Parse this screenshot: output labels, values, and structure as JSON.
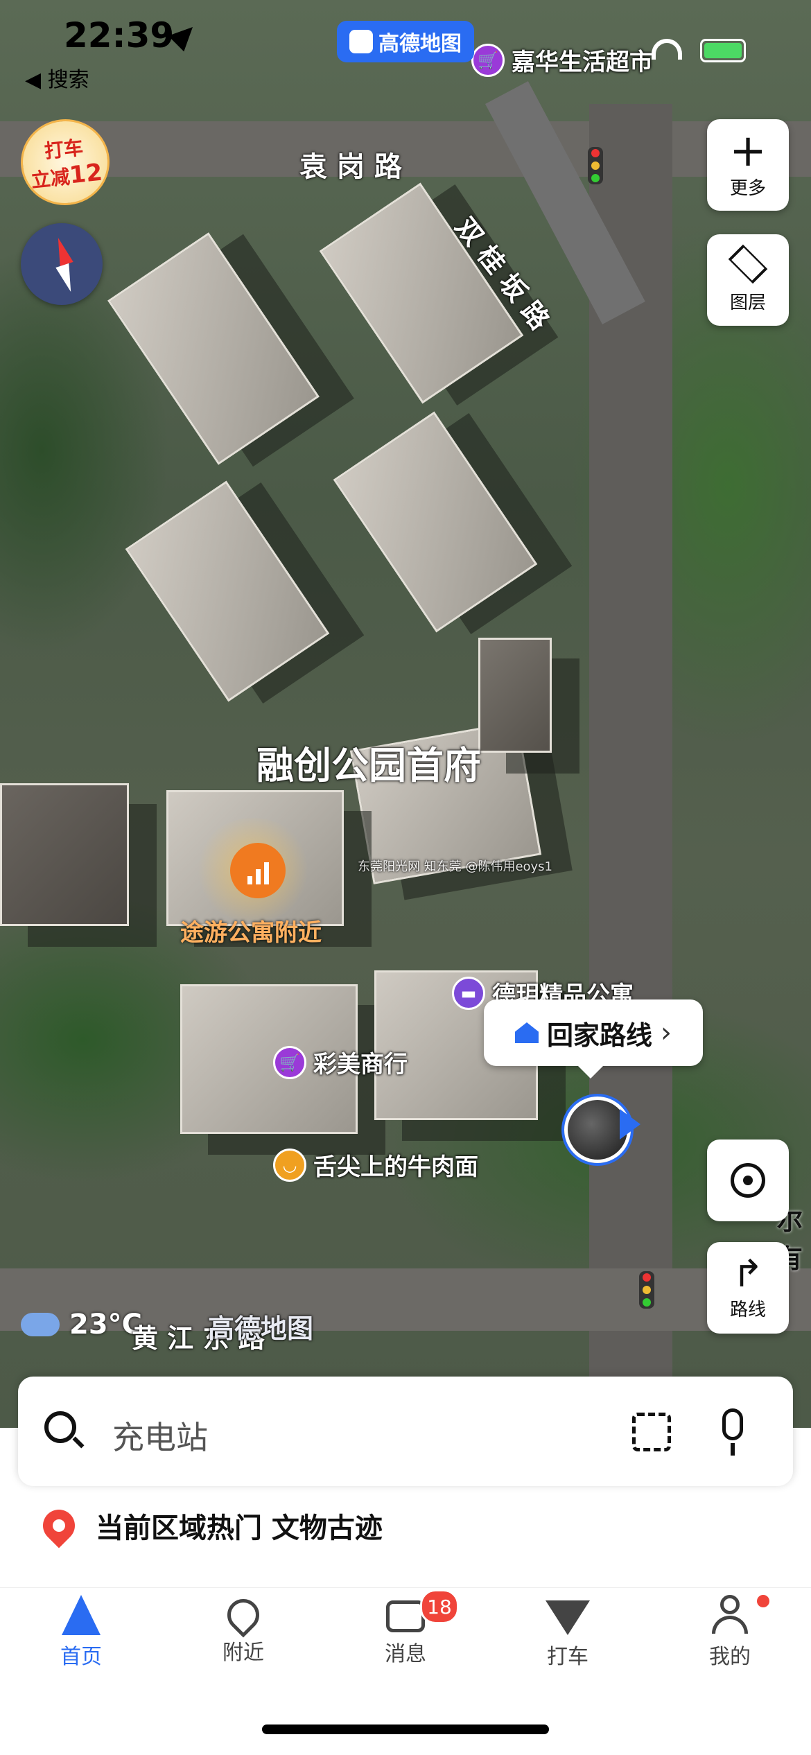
{
  "status_bar": {
    "time": "22:39",
    "back_label": "◀ 搜索"
  },
  "map_badge": {
    "label": "高德地图"
  },
  "promo": {
    "line1": "打车",
    "line2": "立减",
    "number": "12"
  },
  "map_labels": {
    "road_yuangang": "袁 岗 路",
    "road_diagonal": "双 桂 坂 路",
    "complex_name": "融创公园首府",
    "poi_tuyou": "途游公寓附近",
    "watermark": "东莞阳光网 知东莞 @陈伟用eoys1",
    "weather": "23°C",
    "bottom_watermark": "高德地图",
    "bottom_road": "黄 江 东 路",
    "edge_text": "尔\n有"
  },
  "pois": [
    {
      "name": "嘉华生活超市",
      "color": "#9a3ad8",
      "icon": "cart-icon"
    },
    {
      "name": "德玥精品公寓",
      "color": "#7c4ad8",
      "icon": "bed-icon"
    },
    {
      "name": "彩美商行",
      "color": "#9a3ad8",
      "icon": "cart-icon"
    },
    {
      "name": "舌尖上的牛肉面",
      "color": "#f0a020",
      "icon": "bowl-icon"
    }
  ],
  "controls": {
    "more_label": "更多",
    "layers_label": "图层",
    "route_label": "路线"
  },
  "route_bubble": {
    "label": "回家路线"
  },
  "search": {
    "placeholder": "充电站"
  },
  "hot": {
    "text": "当前区域热门 文物古迹"
  },
  "tabs": [
    {
      "label": "首页",
      "icon": "navigation-arrow-icon",
      "active": true
    },
    {
      "label": "附近",
      "icon": "location-pin-icon"
    },
    {
      "label": "消息",
      "icon": "message-icon",
      "badge": "18"
    },
    {
      "label": "打车",
      "icon": "taxi-icon"
    },
    {
      "label": "我的",
      "icon": "person-icon"
    }
  ],
  "colors": {
    "accent": "#2a6cf2",
    "badge_red": "#f0443a"
  }
}
